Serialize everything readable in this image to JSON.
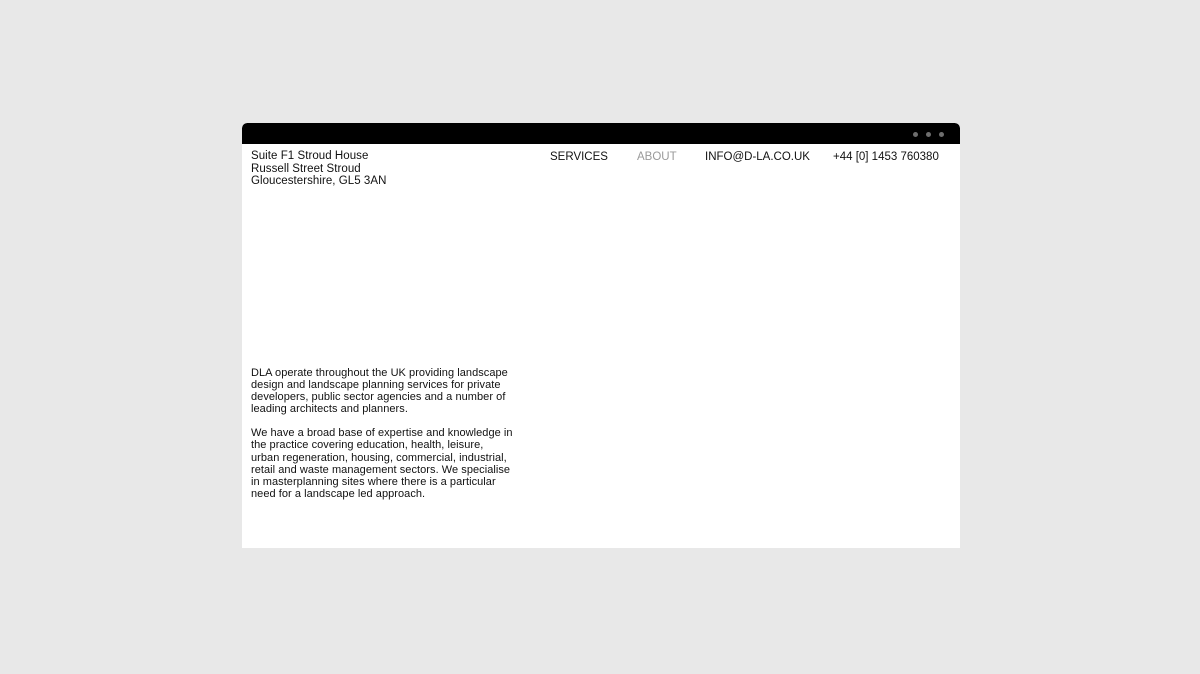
{
  "window": {
    "controls": [
      "dot",
      "dot",
      "dot"
    ]
  },
  "address": {
    "line1": "Suite F1 Stroud House",
    "line2": "Russell Street Stroud",
    "line3": "Gloucestershire, GL5 3AN"
  },
  "nav": {
    "services": "SERVICES",
    "about": "ABOUT",
    "email": "INFO@D-LA.CO.UK",
    "phone": "+44 [0] 1453 760380"
  },
  "colors": {
    "background": "#e8e8e8",
    "title_bar": "#000000",
    "page": "#ffffff",
    "text": "#111111",
    "muted_link": "#9a9a9a"
  },
  "intro": {
    "paragraph1": "DLA operate throughout the UK providing landscape design and landscape planning services for private developers, public sector agencies and a number of leading architects and planners.",
    "paragraph2": "We have a broad base of expertise and knowledge in the practice covering education, health, leisure, urban regeneration, housing, commercial, industrial, retail and waste management sectors. We specialise in masterplanning sites where there is a particular need for a landscape led approach."
  }
}
